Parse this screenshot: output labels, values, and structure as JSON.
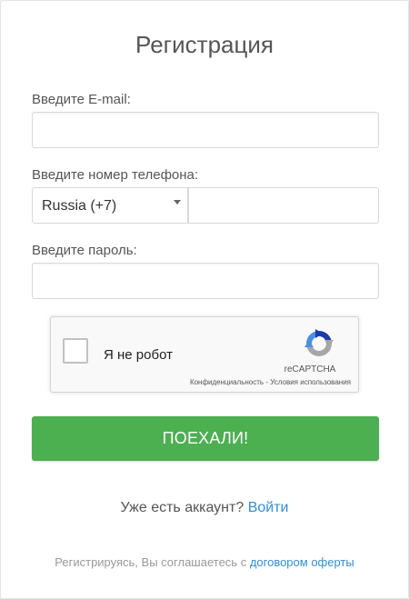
{
  "form": {
    "title": "Регистрация",
    "email_label": "Введите E-mail:",
    "email_value": "",
    "phone_label": "Введите номер телефона:",
    "country_selected": "Russia (+7)",
    "phone_value": "",
    "password_label": "Введите пароль:",
    "password_value": ""
  },
  "captcha": {
    "label": "Я не робот",
    "brand": "reCAPTCHA",
    "privacy": "Конфиденциальность",
    "separator": " - ",
    "terms": "Условия использования",
    "checked": false
  },
  "submit_label": "ПОЕХАЛИ!",
  "login": {
    "prompt": "Уже есть аккаунт? ",
    "link": "Войти"
  },
  "terms": {
    "text": "Регистрируясь, Вы соглашаетесь с ",
    "link": "договором оферты"
  },
  "colors": {
    "accent_green": "#4caf50",
    "link_blue": "#2f8fd8",
    "text_gray": "#555555"
  }
}
